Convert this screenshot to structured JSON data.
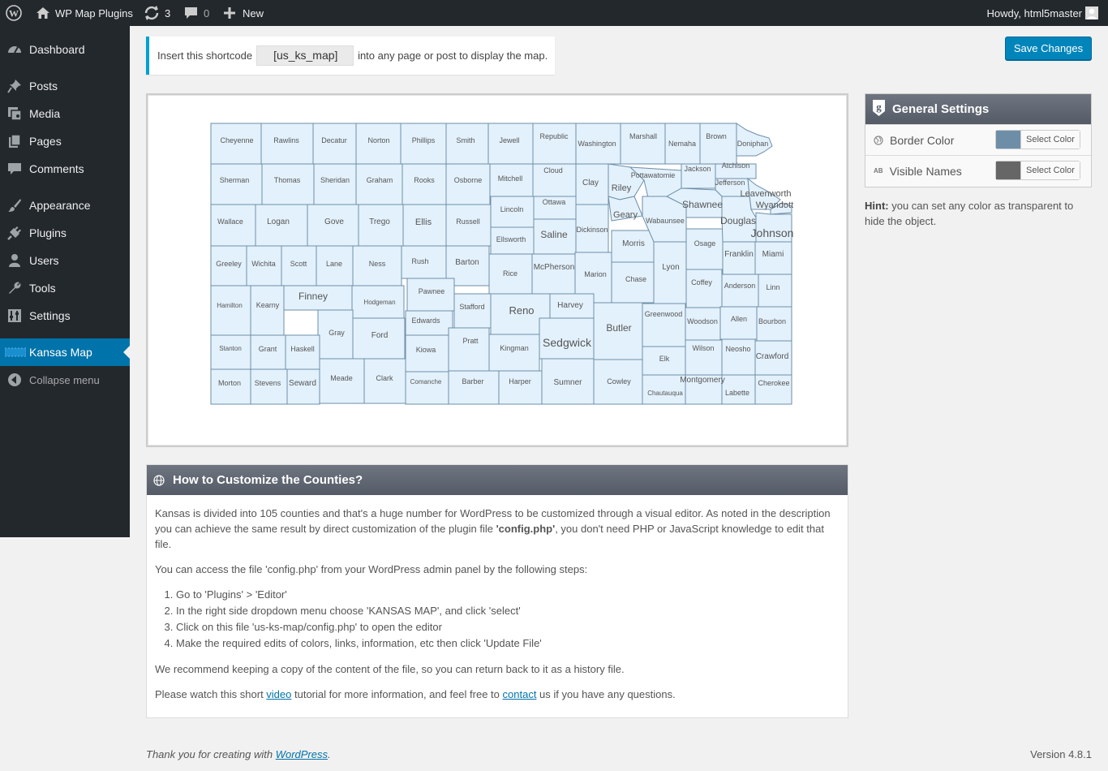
{
  "adminbar": {
    "site_name": "WP Map Plugins",
    "updates_count": "3",
    "comments_count": "0",
    "new_label": "New",
    "greeting": "Howdy, html5master"
  },
  "menu": {
    "items": [
      {
        "label": "Dashboard",
        "icon": "dashboard-icon"
      },
      {
        "label": "Posts",
        "icon": "pin-icon"
      },
      {
        "label": "Media",
        "icon": "media-icon"
      },
      {
        "label": "Pages",
        "icon": "pages-icon"
      },
      {
        "label": "Comments",
        "icon": "comments-icon"
      },
      {
        "label": "Appearance",
        "icon": "brush-icon"
      },
      {
        "label": "Plugins",
        "icon": "plug-icon"
      },
      {
        "label": "Users",
        "icon": "user-icon"
      },
      {
        "label": "Tools",
        "icon": "wrench-icon"
      },
      {
        "label": "Settings",
        "icon": "sliders-icon"
      },
      {
        "label": "Kansas Map",
        "icon": "map-icon"
      },
      {
        "label": "Collapse menu",
        "icon": "collapse-icon"
      }
    ],
    "current": "Kansas Map"
  },
  "notice": {
    "prefix": "Insert this shortcode",
    "shortcode": "[us_ks_map]",
    "suffix": "into any page or post to display the map."
  },
  "save_button": "Save Changes",
  "map": {
    "fill_color": "#e3f1fc",
    "border_color": "#6e8ea8",
    "names_color": "#555555",
    "counties": [
      "Cheyenne",
      "Rawlins",
      "Decatur",
      "Norton",
      "Phillips",
      "Smith",
      "Jewell",
      "Republic",
      "Washington",
      "Marshall",
      "Nemaha",
      "Brown",
      "Doniphan",
      "Sherman",
      "Thomas",
      "Sheridan",
      "Graham",
      "Rooks",
      "Osborne",
      "Mitchell",
      "Cloud",
      "Clay",
      "Riley",
      "Pottawatomie",
      "Jackson",
      "Atchison",
      "Jefferson",
      "Leavenworth",
      "Wyandotte",
      "Wallace",
      "Logan",
      "Gove",
      "Trego",
      "Ellis",
      "Russell",
      "Lincoln",
      "Ottawa",
      "Saline",
      "Dickinson",
      "Geary",
      "Wabaunsee",
      "Shawnee",
      "Douglas",
      "Johnson",
      "Ellsworth",
      "Morris",
      "Osage",
      "Franklin",
      "Miami",
      "Greeley",
      "Wichita",
      "Scott",
      "Lane",
      "Ness",
      "Rush",
      "Barton",
      "Rice",
      "McPherson",
      "Marion",
      "Chase",
      "Lyon",
      "Coffey",
      "Anderson",
      "Linn",
      "Pawnee",
      "Hamilton",
      "Kearny",
      "Finney",
      "Hodgeman",
      "Stafford",
      "Reno",
      "Harvey",
      "Butler",
      "Greenwood",
      "Woodson",
      "Allen",
      "Bourbon",
      "Edwards",
      "Gray",
      "Ford",
      "Kiowa",
      "Pratt",
      "Kingman",
      "Sedgwick",
      "Elk",
      "Wilson",
      "Neosho",
      "Crawford",
      "Stanton",
      "Grant",
      "Haskell",
      "Meade",
      "Clark",
      "Comanche",
      "Barber",
      "Harper",
      "Sumner",
      "Cowley",
      "Chautauqua",
      "Montgomery",
      "Labette",
      "Cherokee",
      "Morton",
      "Stevens",
      "Seward"
    ]
  },
  "settings": {
    "title": "General Settings",
    "rows": [
      {
        "label": "Border Color",
        "color": "#6e8ea8",
        "button": "Select Color",
        "icon": "globe-icon"
      },
      {
        "label": "Visible Names",
        "color": "#666666",
        "button": "Select Color",
        "icon": "ab-text-icon"
      }
    ],
    "hint_bold": "Hint:",
    "hint_text": " you can set any color as transparent to hide the object."
  },
  "customize": {
    "title": "How to Customize the Counties?",
    "p1_a": "Kansas is divided into 105 counties and that's a huge number for WordPress to be customized through a visual editor. As noted in the description you can achieve the same result by direct customization of the plugin file ",
    "p1_b": "'config.php'",
    "p1_c": ", you don't need PHP or JavaScript knowledge to edit that file.",
    "p2": "You can access the file 'config.php' from your WordPress admin panel by the following steps:",
    "steps": [
      "Go to 'Plugins' > 'Editor'",
      "In the right side dropdown menu choose 'KANSAS MAP', and click 'select'",
      "Click on this file 'us-ks-map/config.php' to open the editor",
      "Make the required edits of colors, links, information, etc then click 'Update File'"
    ],
    "p3": "We recommend keeping a copy of the content of the file, so you can return back to it as a history file.",
    "p4_a": "Please watch this short ",
    "p4_link1": "video",
    "p4_b": " tutorial for more information, and feel free to ",
    "p4_link2": "contact",
    "p4_c": " us if you have any questions."
  },
  "footer": {
    "thanks_prefix": "Thank you for creating with ",
    "wp_link": "WordPress",
    "thanks_suffix": ".",
    "version": "Version 4.8.1"
  }
}
